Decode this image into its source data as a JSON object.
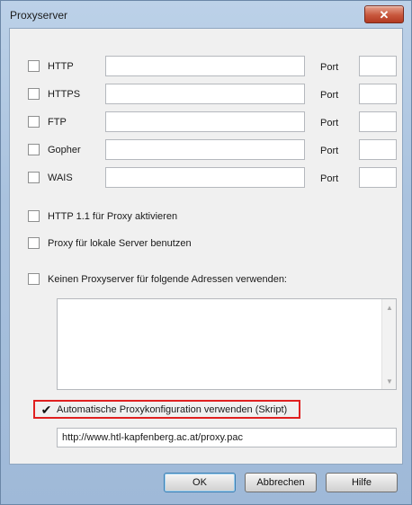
{
  "window": {
    "title": "Proxyserver",
    "close_icon": "close-icon"
  },
  "protocols": [
    {
      "label": "HTTP",
      "port_label": "Port",
      "address": "",
      "port": "",
      "checked": false
    },
    {
      "label": "HTTPS",
      "port_label": "Port",
      "address": "",
      "port": "",
      "checked": false
    },
    {
      "label": "FTP",
      "port_label": "Port",
      "address": "",
      "port": "",
      "checked": false
    },
    {
      "label": "Gopher",
      "port_label": "Port",
      "address": "",
      "port": "",
      "checked": false
    },
    {
      "label": "WAIS",
      "port_label": "Port",
      "address": "",
      "port": "",
      "checked": false
    }
  ],
  "options": {
    "http11": {
      "label": "HTTP 1.1 für Proxy aktivieren",
      "checked": false
    },
    "local_servers": {
      "label": "Proxy für lokale Server benutzen",
      "checked": false
    },
    "bypass": {
      "label": "Keinen Proxyserver für folgende Adressen verwenden:",
      "checked": false,
      "addresses": ""
    },
    "auto_config": {
      "label": "Automatische Proxykonfiguration verwenden (Skript)",
      "checked": true,
      "url": "http://www.htl-kapfenberg.ac.at/proxy.pac",
      "highlight_color": "#e02020"
    }
  },
  "buttons": {
    "ok": "OK",
    "cancel": "Abbrechen",
    "help": "Hilfe"
  }
}
